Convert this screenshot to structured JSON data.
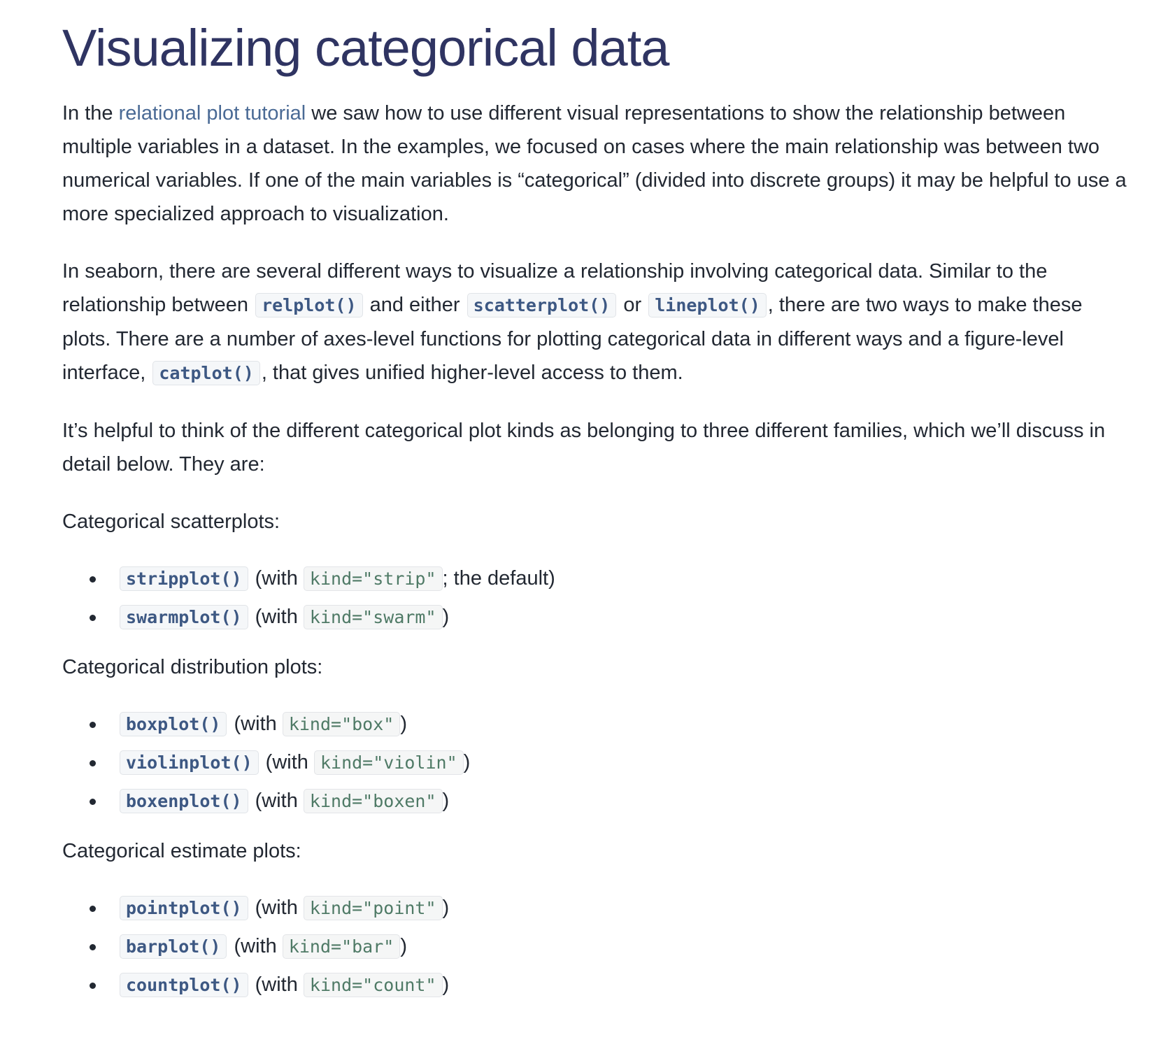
{
  "title": "Visualizing categorical data",
  "intro": {
    "before_link": "In the ",
    "link_text": "relational plot tutorial",
    "after_link": " we saw how to use different visual representations to show the relationship between multiple variables in a dataset. In the examples, we focused on cases where the main relationship was between two numerical variables. If one of the main variables is “categorical” (divided into discrete groups) it may be helpful to use a more specialized approach to visualization."
  },
  "para2": {
    "t1": "In seaborn, there are several different ways to visualize a relationship involving categorical data. Similar to the relationship between ",
    "code1": "relplot()",
    "t2": " and either ",
    "code2": "scatterplot()",
    "t3": " or ",
    "code3": "lineplot()",
    "t4": ", there are two ways to make these plots. There are a number of axes-level functions for plotting categorical data in different ways and a figure-level interface, ",
    "code4": "catplot()",
    "t5": ", that gives unified higher-level access to them."
  },
  "para3": "It’s helpful to think of the different categorical plot kinds as belonging to three different families, which we’ll discuss in detail below. They are:",
  "with_text": " (with ",
  "close_paren": ")",
  "families": [
    {
      "heading": "Categorical scatterplots:",
      "items": [
        {
          "fn": "stripplot()",
          "kind": "kind=\"strip\"",
          "suffix": "; the default)"
        },
        {
          "fn": "swarmplot()",
          "kind": "kind=\"swarm\"",
          "suffix": ")"
        }
      ]
    },
    {
      "heading": "Categorical distribution plots:",
      "items": [
        {
          "fn": "boxplot()",
          "kind": "kind=\"box\"",
          "suffix": ")"
        },
        {
          "fn": "violinplot()",
          "kind": "kind=\"violin\"",
          "suffix": ")"
        },
        {
          "fn": "boxenplot()",
          "kind": "kind=\"boxen\"",
          "suffix": ")"
        }
      ]
    },
    {
      "heading": "Categorical estimate plots:",
      "items": [
        {
          "fn": "pointplot()",
          "kind": "kind=\"point\"",
          "suffix": ")"
        },
        {
          "fn": "barplot()",
          "kind": "kind=\"bar\"",
          "suffix": ")"
        },
        {
          "fn": "countplot()",
          "kind": "kind=\"count\"",
          "suffix": ")"
        }
      ]
    }
  ]
}
